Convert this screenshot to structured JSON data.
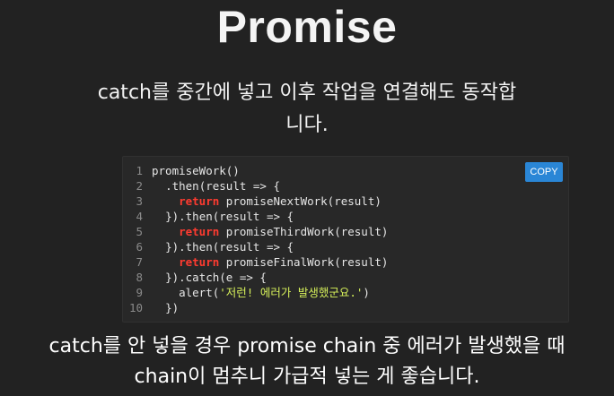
{
  "slide": {
    "title": "Promise",
    "description_line1": "catch를 중간에 넣고 이후 작업을 연결해도 동작합",
    "description_line2": "니다."
  },
  "code": {
    "copy_label": "COPY",
    "lines": [
      {
        "n": "1",
        "indent": "",
        "pre": "promiseWork()",
        "kw": "",
        "post": "",
        "str": "",
        "tail": ""
      },
      {
        "n": "2",
        "indent": "  ",
        "pre": ".then(result => {",
        "kw": "",
        "post": "",
        "str": "",
        "tail": ""
      },
      {
        "n": "3",
        "indent": "    ",
        "pre": "",
        "kw": "return",
        "post": " promiseNextWork(result)",
        "str": "",
        "tail": ""
      },
      {
        "n": "4",
        "indent": "  ",
        "pre": "}).then(result => {",
        "kw": "",
        "post": "",
        "str": "",
        "tail": ""
      },
      {
        "n": "5",
        "indent": "    ",
        "pre": "",
        "kw": "return",
        "post": " promiseThirdWork(result)",
        "str": "",
        "tail": ""
      },
      {
        "n": "6",
        "indent": "  ",
        "pre": "}).then(result => {",
        "kw": "",
        "post": "",
        "str": "",
        "tail": ""
      },
      {
        "n": "7",
        "indent": "    ",
        "pre": "",
        "kw": "return",
        "post": " promiseFinalWork(result)",
        "str": "",
        "tail": ""
      },
      {
        "n": "8",
        "indent": "  ",
        "pre": "}).catch(e => {",
        "kw": "",
        "post": "",
        "str": "",
        "tail": ""
      },
      {
        "n": "9",
        "indent": "    ",
        "pre": "alert(",
        "kw": "",
        "post": "",
        "str": "'저런! 에러가 발생했군요.'",
        "tail": ")"
      },
      {
        "n": "10",
        "indent": "  ",
        "pre": "})",
        "kw": "",
        "post": "",
        "str": "",
        "tail": ""
      }
    ]
  },
  "caption": {
    "line1": "catch를 안 넣을 경우 promise chain 중 에러가 발생했을 때",
    "line2": "chain이 멈추니 가급적 넣는 게 좋습니다."
  },
  "colors": {
    "background": "#222222",
    "code_background": "#282828",
    "keyword": "#ff3b30",
    "string": "#d6f05a",
    "copy_button": "#2a86d6"
  }
}
